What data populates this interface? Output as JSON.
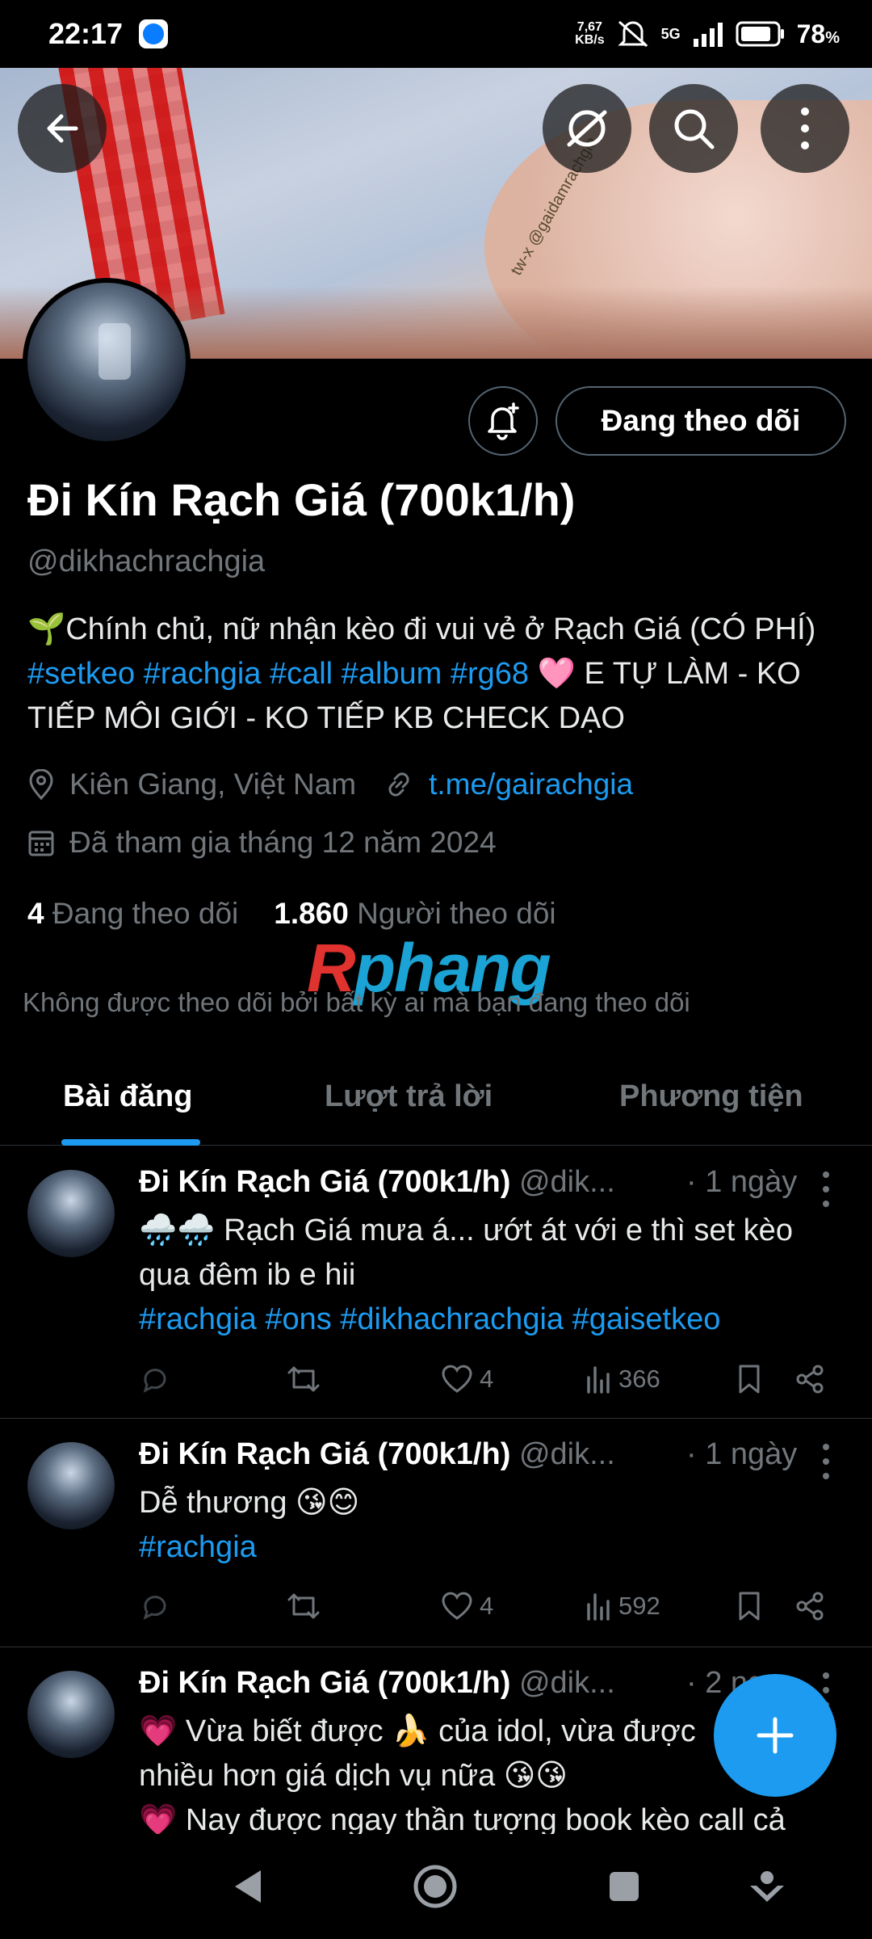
{
  "status_bar": {
    "time": "22:17",
    "speed_value": "7,67",
    "speed_unit": "KB/s",
    "network": "5G",
    "battery": "78",
    "battery_unit": "%"
  },
  "profile": {
    "name": "Đi Kín Rạch Giá (700k1/h)",
    "handle": "@dikhachrachgia",
    "following_button": "Đang theo dõi",
    "bio_text_1": "🌱Chính chủ, nữ nhận kèo đi vui vẻ ở Rạch Giá (CÓ PHÍ)",
    "bio_tags": "#setkeo #rachgia #call #album #rg68",
    "bio_text_2": "🩷 E TỰ LÀM - KO TIẾP MÔI GIỚI - KO TIẾP KB CHECK DẠO",
    "location": "Kiên Giang, Việt Nam",
    "link": "t.me/gairachgia",
    "joined": "Đã tham gia tháng 12 năm 2024",
    "following_count": "4",
    "following_label": "Đang theo dõi",
    "followers_count": "1.860",
    "followers_label": "Người theo dõi",
    "not_followed_by": "Không được theo dõi bởi bất kỳ ai mà bạn đang theo dõi"
  },
  "banner": {
    "watermark_text": "tw-x @gaidamrachgia"
  },
  "watermark": {
    "r": "R",
    "rest": "phang"
  },
  "tabs": [
    {
      "label": "Bài đăng",
      "active": true
    },
    {
      "label": "Lượt trả lời",
      "active": false
    },
    {
      "label": "Phương tiện",
      "active": false
    }
  ],
  "tweets": [
    {
      "name": "Đi Kín Rạch Giá (700k1/h)",
      "handle": "@dik...",
      "time": "· 1 ngày",
      "line1": "🌧️🌧️ Rạch Giá mưa á... ướt át với e thì set kèo qua đêm ib e hii",
      "tags": "#rachgia #ons #dikhachrachgia #gaisetkeo",
      "likes": "4",
      "views": "366"
    },
    {
      "name": "Đi Kín Rạch Giá (700k1/h)",
      "handle": "@dik...",
      "time": "· 1 ngày",
      "line1": "Dễ thương 😘😊",
      "tags": "#rachgia",
      "likes": "4",
      "views": "592"
    },
    {
      "name": "Đi Kín Rạch Giá (700k1/h)",
      "handle": "@dik...",
      "time": "· 2 ng",
      "line1": "💗 Vừa biết được 🍌 của idol, vừa được",
      "line2": "nhiều hơn giá dịch vụ nữa 😘😘",
      "line3": "💗 Nay được ngay thần tượng book kèo call cả"
    }
  ],
  "colors": {
    "accent": "#1d9bf0",
    "muted": "#71767b",
    "background": "#000000"
  }
}
